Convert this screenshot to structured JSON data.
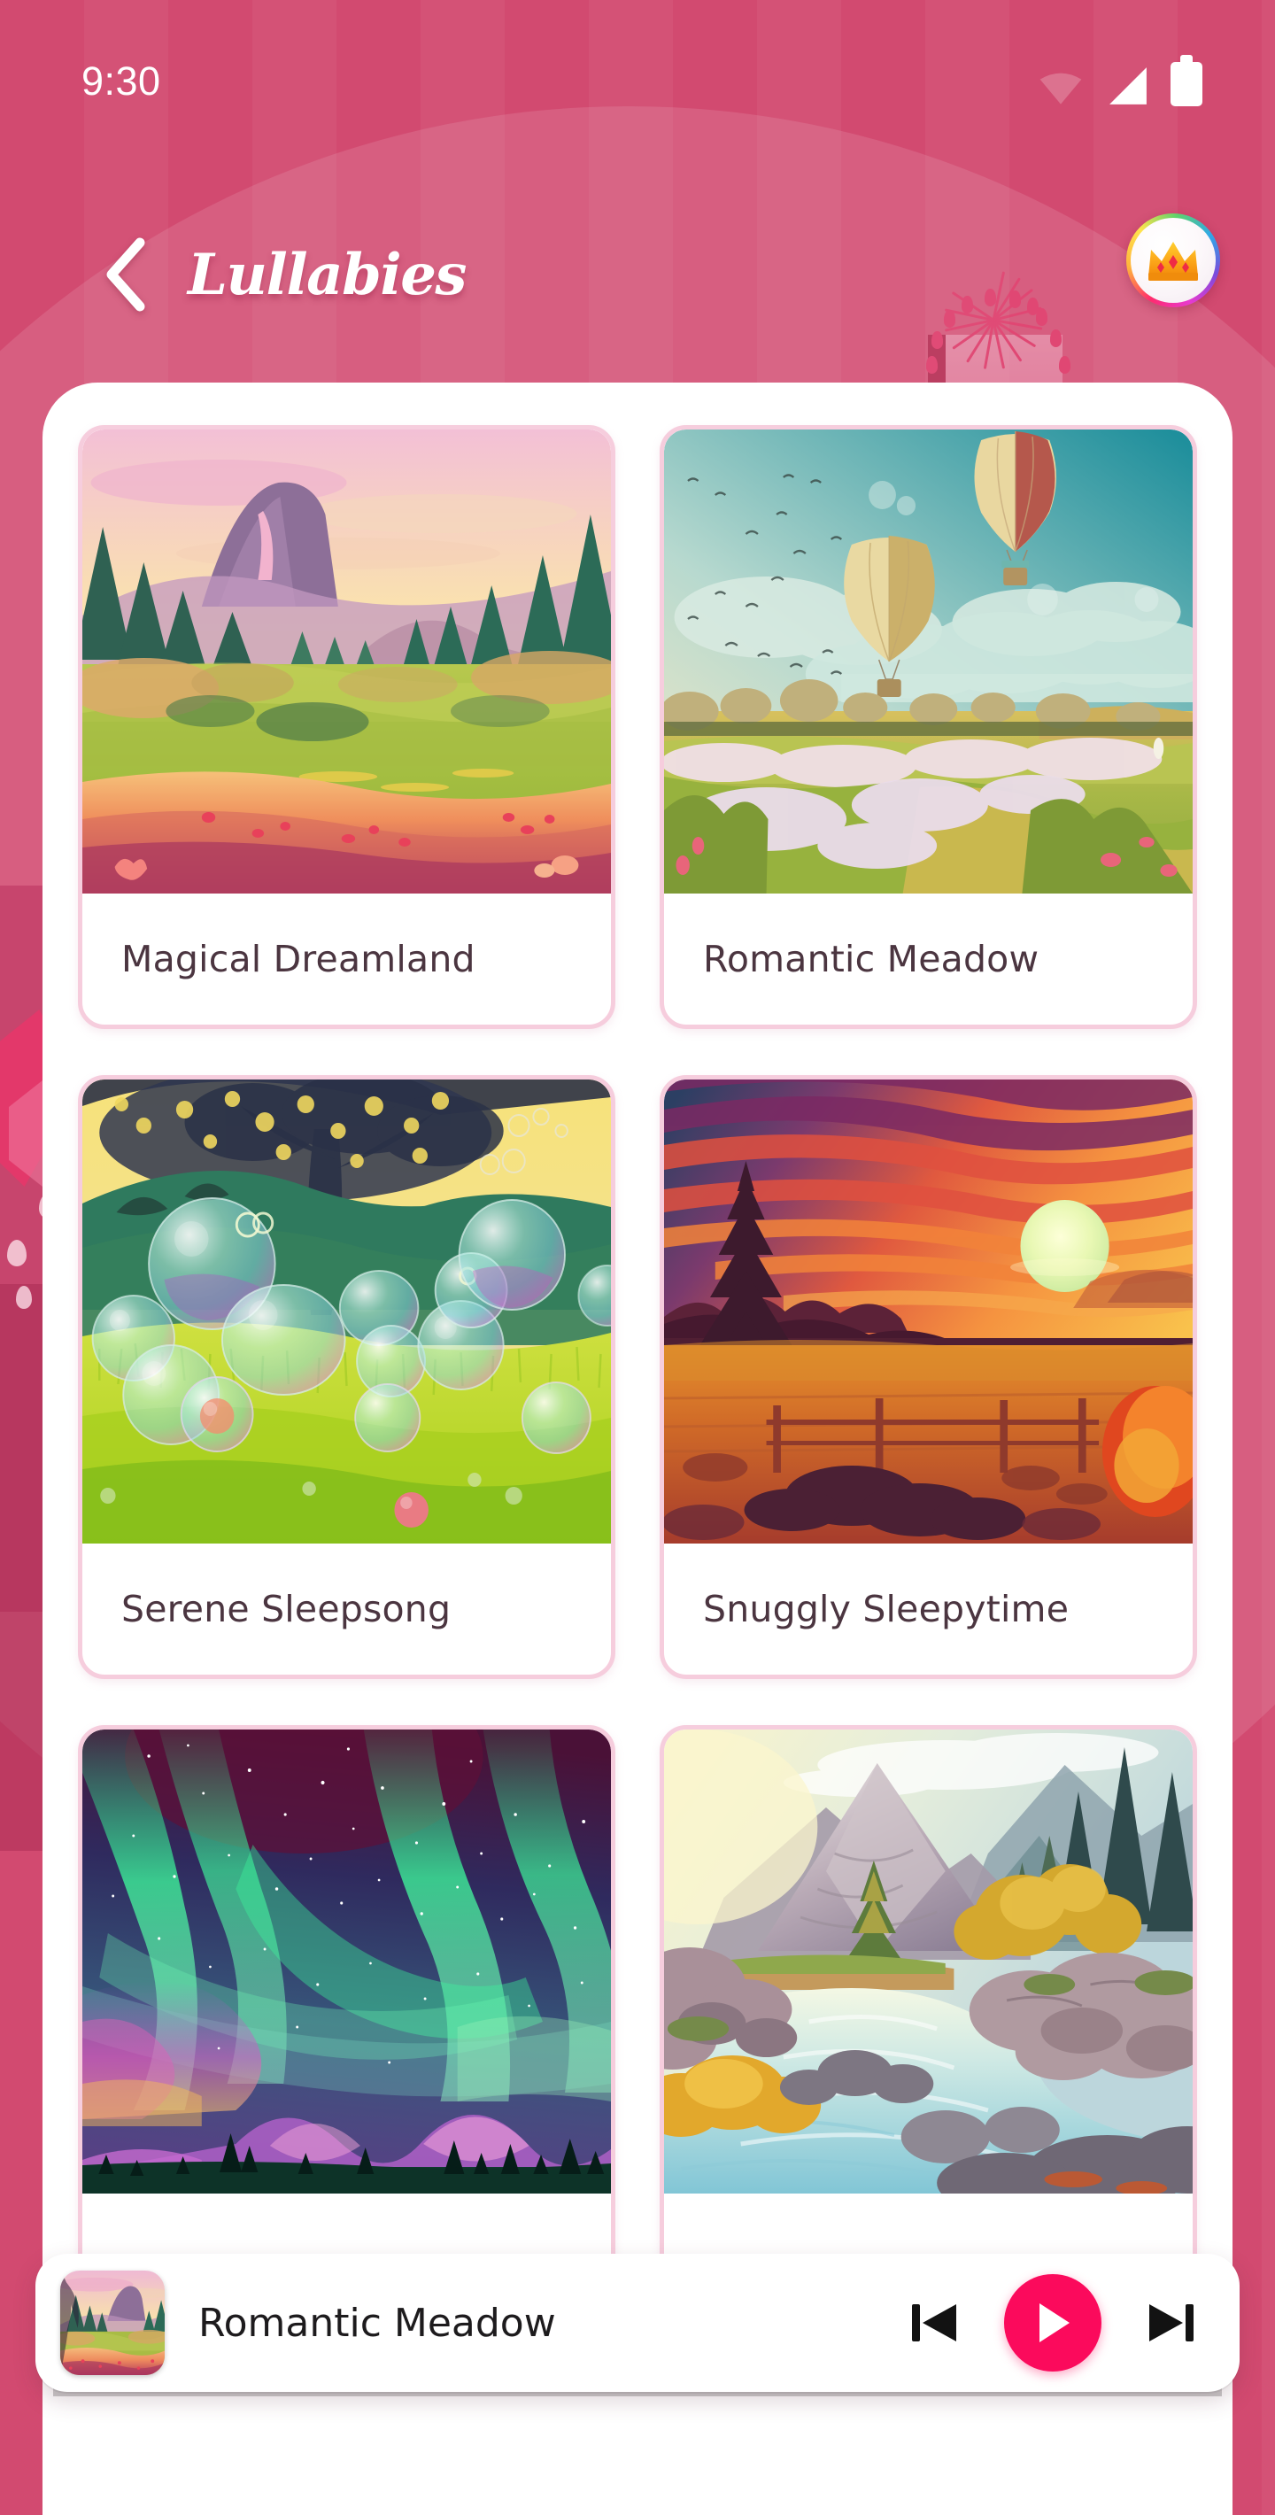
{
  "statusbar": {
    "time": "9:30",
    "icons": [
      "wifi-icon",
      "signal-icon",
      "battery-icon"
    ]
  },
  "header": {
    "back_label": "‹",
    "title": "Lullabies",
    "premium_badge_icon": "crown-icon",
    "back_icon": "chevron-left-icon"
  },
  "colors": {
    "background_pink": "#d24a70",
    "accent_pink": "#fb0a5c",
    "card_border": "#f6cddd",
    "card_text": "#4b3540",
    "panel_white": "#ffffff"
  },
  "grid": {
    "items": [
      {
        "title": "Magical Dreamland",
        "art": "sunset-mountain-meadow"
      },
      {
        "title": "Romantic Meadow",
        "art": "hot-air-balloons-field"
      },
      {
        "title": "Serene Sleepsong",
        "art": "soap-bubbles-grass"
      },
      {
        "title": "Snuggly Sleepytime",
        "art": "sunset-lake-pines"
      },
      {
        "title": "",
        "art": "aurora-borealis-night"
      },
      {
        "title": "",
        "art": "mountain-river-rocks"
      }
    ]
  },
  "player": {
    "now_playing": "Romantic Meadow",
    "thumb_art": "sunset-mountain-meadow",
    "prev_icon": "skip-previous-icon",
    "play_icon": "play-icon",
    "next_icon": "skip-next-icon"
  }
}
